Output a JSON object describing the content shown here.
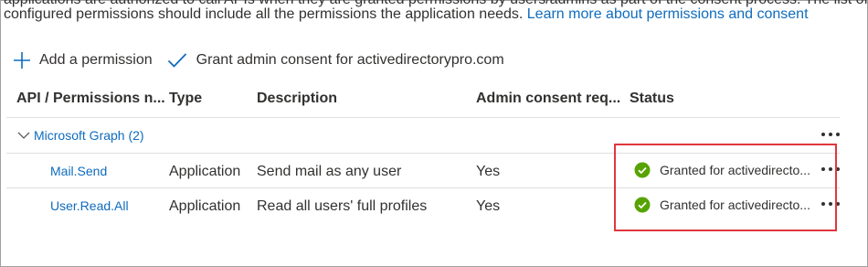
{
  "intro": {
    "cut_text": "applications are authorized to call APIs when they are granted permissions by users/admins as part of the consent process. The list of",
    "text": "configured permissions should include all the permissions the application needs.",
    "link": "Learn more about permissions and consent"
  },
  "toolbar": {
    "add_label": "Add a permission",
    "grant_label": "Grant admin consent for activedirectorypro.com"
  },
  "table": {
    "headers": {
      "api": "API / Permissions n...",
      "type": "Type",
      "description": "Description",
      "admin_consent": "Admin consent req...",
      "status": "Status"
    },
    "group": {
      "label": "Microsoft Graph (2)"
    },
    "rows": [
      {
        "name": "Mail.Send",
        "type": "Application",
        "description": "Send mail as any user",
        "admin_consent": "Yes",
        "status": "Granted for activedirecto..."
      },
      {
        "name": "User.Read.All",
        "type": "Application",
        "description": "Read all users' full profiles",
        "admin_consent": "Yes",
        "status": "Granted for activedirecto..."
      }
    ]
  },
  "colors": {
    "link": "#0f6cbd",
    "success": "#57a300",
    "highlight": "#e0373f"
  },
  "icons": {
    "add": "plus-icon",
    "grant": "checkmark-icon",
    "group_toggle": "chevron-down-icon",
    "status": "check-circle-icon",
    "more": "more-icon"
  }
}
